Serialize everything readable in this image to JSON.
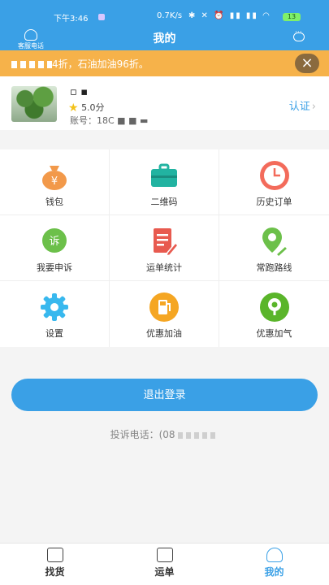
{
  "status_bar": {
    "time": "下午3:46",
    "net_speed": "0.7K/s",
    "battery": "13"
  },
  "header": {
    "service_label": "客服电话",
    "title": "我的"
  },
  "promo": {
    "text_suffix": "4折，石油加油96折。"
  },
  "profile": {
    "name_masked": "▫ ▪",
    "rating": "5.0分",
    "account": "账号：18C ■ ■  ▬",
    "verify_label": "认证"
  },
  "menu": [
    {
      "label": "钱包",
      "icon": "money-bag-icon"
    },
    {
      "label": "二维码",
      "icon": "briefcase-icon"
    },
    {
      "label": "历史订单",
      "icon": "clock-icon"
    },
    {
      "label": "我要申诉",
      "icon": "complaint-icon"
    },
    {
      "label": "运单统计",
      "icon": "document-edit-icon"
    },
    {
      "label": "常跑路线",
      "icon": "location-pin-icon"
    },
    {
      "label": "设置",
      "icon": "gear-icon"
    },
    {
      "label": "优惠加油",
      "icon": "fuel-icon"
    },
    {
      "label": "优惠加气",
      "icon": "gas-pin-icon"
    }
  ],
  "logout_label": "退出登录",
  "complaint_phone_prefix": "投诉电话：(08",
  "bottom_nav": [
    {
      "label": "找货",
      "icon": "list-icon"
    },
    {
      "label": "运单",
      "icon": "truck-icon"
    },
    {
      "label": "我的",
      "icon": "user-icon"
    }
  ],
  "colors": {
    "primary": "#3aa0e6",
    "banner": "#f6b24a"
  }
}
